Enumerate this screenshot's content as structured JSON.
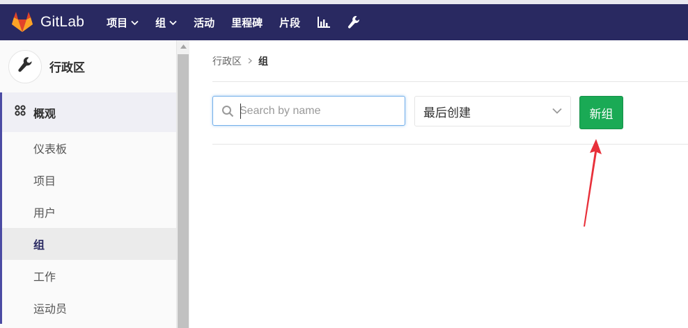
{
  "app": {
    "name": "GitLab"
  },
  "topnav": {
    "items": [
      {
        "label": "项目",
        "has_dropdown": true
      },
      {
        "label": "组",
        "has_dropdown": true
      },
      {
        "label": "活动",
        "has_dropdown": false
      },
      {
        "label": "里程碑",
        "has_dropdown": false
      },
      {
        "label": "片段",
        "has_dropdown": false
      }
    ],
    "icons": [
      "chart-icon",
      "wrench-icon"
    ]
  },
  "sidebar": {
    "title": "行政区",
    "section": {
      "label": "概观",
      "icon": "grid-icon"
    },
    "items": [
      {
        "label": "仪表板",
        "active": false
      },
      {
        "label": "项目",
        "active": false
      },
      {
        "label": "用户",
        "active": false
      },
      {
        "label": "组",
        "active": true
      },
      {
        "label": "工作",
        "active": false
      },
      {
        "label": "运动员",
        "active": false
      }
    ]
  },
  "breadcrumb": {
    "parent": "行政区",
    "current": "组"
  },
  "search": {
    "placeholder": "Search by name",
    "value": ""
  },
  "sort": {
    "selected": "最后创建"
  },
  "new_group_button": {
    "label": "新组"
  },
  "colors": {
    "topbar": "#292961",
    "accent": "#4b4ba3",
    "button_green": "#1aaa55",
    "annotation_red": "#e8303a"
  }
}
